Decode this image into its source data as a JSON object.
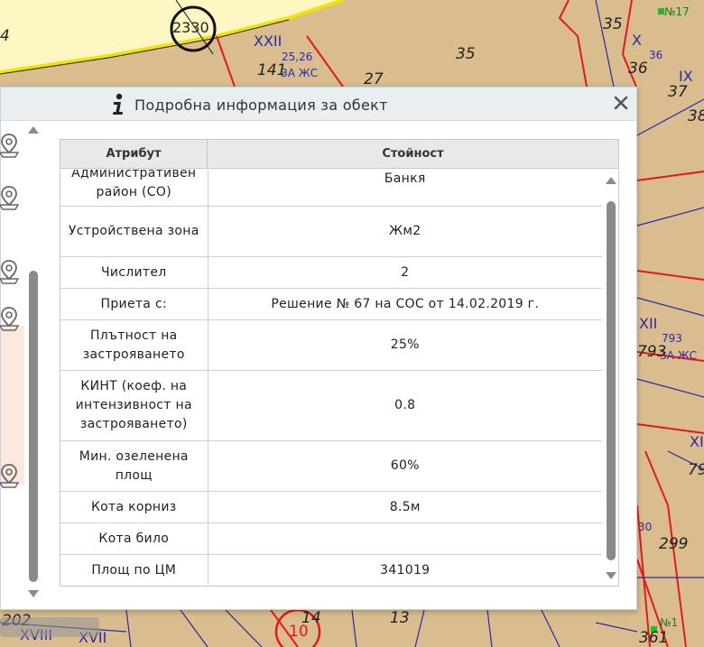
{
  "map": {
    "labels": {
      "l2330": "2330",
      "lxxii_top": "XXII",
      "l25_26": "25,26",
      "lzazhs_top": "ЗА ЖС",
      "l141": "141",
      "l27": "27",
      "l35a": "35",
      "l35b": "35",
      "lx": "X",
      "l36": "36",
      "l36b": "36",
      "l37": "37",
      "lix": "IX",
      "l38": "38",
      "ln17": "№17",
      "l4": "4",
      "lxii": "XII",
      "l793": "793",
      "l793b": "793",
      "lzazhs_mid": "ЗА ЖС",
      "lxi": "XI",
      "l79": "79",
      "l30": "30",
      "l299": "299",
      "l202": "202",
      "lxviii": "XVIII",
      "lxvii": "XVII",
      "l14": "14",
      "l10": "10",
      "l13": "13",
      "l361": "361",
      "ln1": "№1"
    }
  },
  "dialog": {
    "title": "Подробна информация за обект",
    "close_symbol": "✕"
  },
  "table": {
    "headers": {
      "attribute": "Атрибут",
      "value": "Стойност"
    },
    "rows": [
      {
        "attribute": "Административен район (СО)",
        "value": "Банкя"
      },
      {
        "attribute": "Устройствена зона",
        "value": "Жм2"
      },
      {
        "attribute": "Числител",
        "value": "2"
      },
      {
        "attribute": "Приета с:",
        "value": "Решение № 67 на СОС от 14.02.2019 г."
      },
      {
        "attribute": "Плътност на застрояването",
        "value": "25%"
      },
      {
        "attribute": "КИНТ (коеф. на интензивност на застрояването)",
        "value": "0.8"
      },
      {
        "attribute": "Мин. озеленена площ",
        "value": "60%"
      },
      {
        "attribute": "Кота корниз",
        "value": "8.5м"
      },
      {
        "attribute": "Кота било",
        "value": ""
      },
      {
        "attribute": "Площ по ЦМ",
        "value": "341019"
      }
    ]
  },
  "icons": {
    "info": "info-icon",
    "close": "close-icon",
    "pin": "map-pin-icon"
  },
  "colors": {
    "parcel_fill": "#d9bd8e",
    "road_fill": "#fff7c2",
    "boundary_red": "#e31a1a",
    "boundary_blue": "#2a2aa8",
    "highlight_row": "#fbe9de"
  }
}
